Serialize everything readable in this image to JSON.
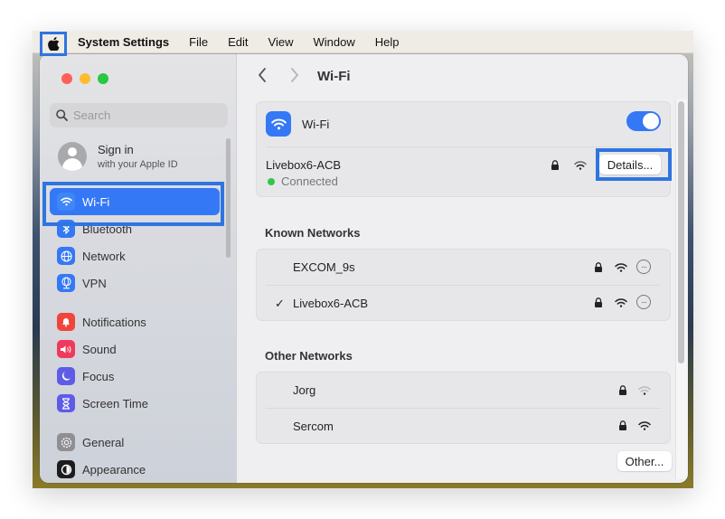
{
  "menubar": {
    "apple_icon": "apple-logo-icon",
    "app_name": "System Settings",
    "items": [
      "File",
      "Edit",
      "View",
      "Window",
      "Help"
    ]
  },
  "colors": {
    "accent": "#3478f6",
    "highlight_outline": "#2f74e0",
    "connected_green": "#32c74a",
    "traffic_red": "#ff5f57",
    "traffic_yellow": "#febc2e",
    "traffic_green": "#28c840"
  },
  "sidebar": {
    "search_placeholder": "Search",
    "account": {
      "title": "Sign in",
      "subtitle": "with your Apple ID"
    },
    "items": [
      {
        "label": "Wi-Fi",
        "icon": "wifi-icon",
        "color": "#3478f6",
        "active": true
      },
      {
        "label": "Bluetooth",
        "icon": "bluetooth-icon",
        "color": "#3478f6",
        "active": false
      },
      {
        "label": "Network",
        "icon": "globe-icon",
        "color": "#3478f6",
        "active": false
      },
      {
        "label": "VPN",
        "icon": "vpn-globe-icon",
        "color": "#3478f6",
        "active": false
      },
      {
        "label": "Notifications",
        "icon": "bell-icon",
        "color": "#f0453a",
        "active": false
      },
      {
        "label": "Sound",
        "icon": "speaker-icon",
        "color": "#ef3a5d",
        "active": false
      },
      {
        "label": "Focus",
        "icon": "moon-icon",
        "color": "#5e5ce6",
        "active": false
      },
      {
        "label": "Screen Time",
        "icon": "hourglass-icon",
        "color": "#5e5ce6",
        "active": false
      },
      {
        "label": "General",
        "icon": "gear-icon",
        "color": "#8e8e93",
        "active": false
      },
      {
        "label": "Appearance",
        "icon": "appearance-icon",
        "color": "#1c1c1e",
        "active": false
      }
    ]
  },
  "main": {
    "title": "Wi-Fi",
    "wifi_toggle": {
      "label": "Wi-Fi",
      "on": true
    },
    "current_network": {
      "name": "Livebox6-ACB",
      "status": "Connected",
      "secured": true,
      "details_label": "Details..."
    },
    "known_networks": {
      "heading": "Known Networks",
      "items": [
        {
          "name": "EXCOM_9s",
          "connected": false,
          "secured": true,
          "signal": "full"
        },
        {
          "name": "Livebox6-ACB",
          "connected": true,
          "secured": true,
          "signal": "full"
        }
      ]
    },
    "other_networks": {
      "heading": "Other Networks",
      "items": [
        {
          "name": "Jorg",
          "secured": true,
          "signal": "weak"
        },
        {
          "name": "Sercom",
          "secured": true,
          "signal": "full"
        }
      ]
    },
    "other_button": "Other...",
    "checkmark": "✓",
    "more_glyph": "···"
  }
}
